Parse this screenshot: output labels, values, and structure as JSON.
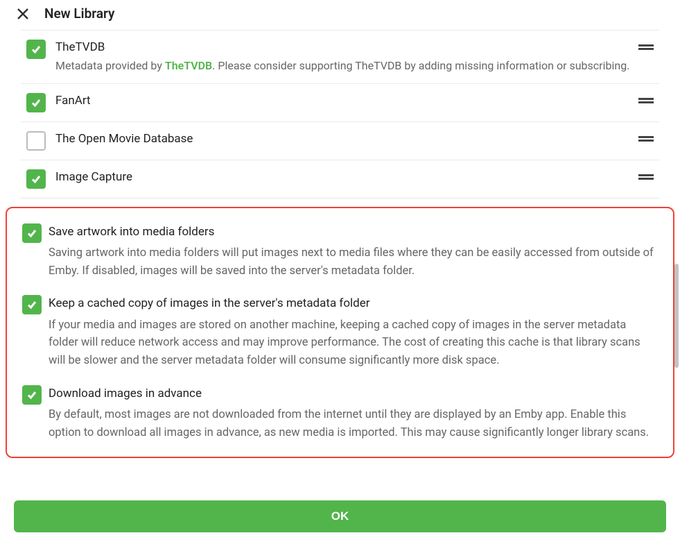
{
  "header": {
    "title": "New Library"
  },
  "providers": [
    {
      "title": "TheTVDB",
      "checked": true,
      "desc_prefix": "Metadata provided by ",
      "desc_link": "TheTVDB",
      "desc_suffix": ". Please consider supporting TheTVDB by adding missing information or subscribing."
    },
    {
      "title": "FanArt",
      "checked": true
    },
    {
      "title": "The Open Movie Database",
      "checked": false
    },
    {
      "title": "Image Capture",
      "checked": true
    }
  ],
  "options": [
    {
      "title": "Save artwork into media folders",
      "desc": "Saving artwork into media folders will put images next to media files where they can be easily accessed from outside of Emby. If disabled, images will be saved into the server's metadata folder."
    },
    {
      "title": "Keep a cached copy of images in the server's metadata folder",
      "desc": "If your media and images are stored on another machine, keeping a cached copy of images in the server metadata folder will reduce network access and may improve performance. The cost of creating this cache is that library scans will be slower and the server metadata folder will consume significantly more disk space."
    },
    {
      "title": "Download images in advance",
      "desc": "By default, most images are not downloaded from the internet until they are displayed by an Emby app. Enable this option to download all images in advance, as new media is imported. This may cause significantly longer library scans."
    }
  ],
  "buttons": {
    "ok": "OK"
  }
}
